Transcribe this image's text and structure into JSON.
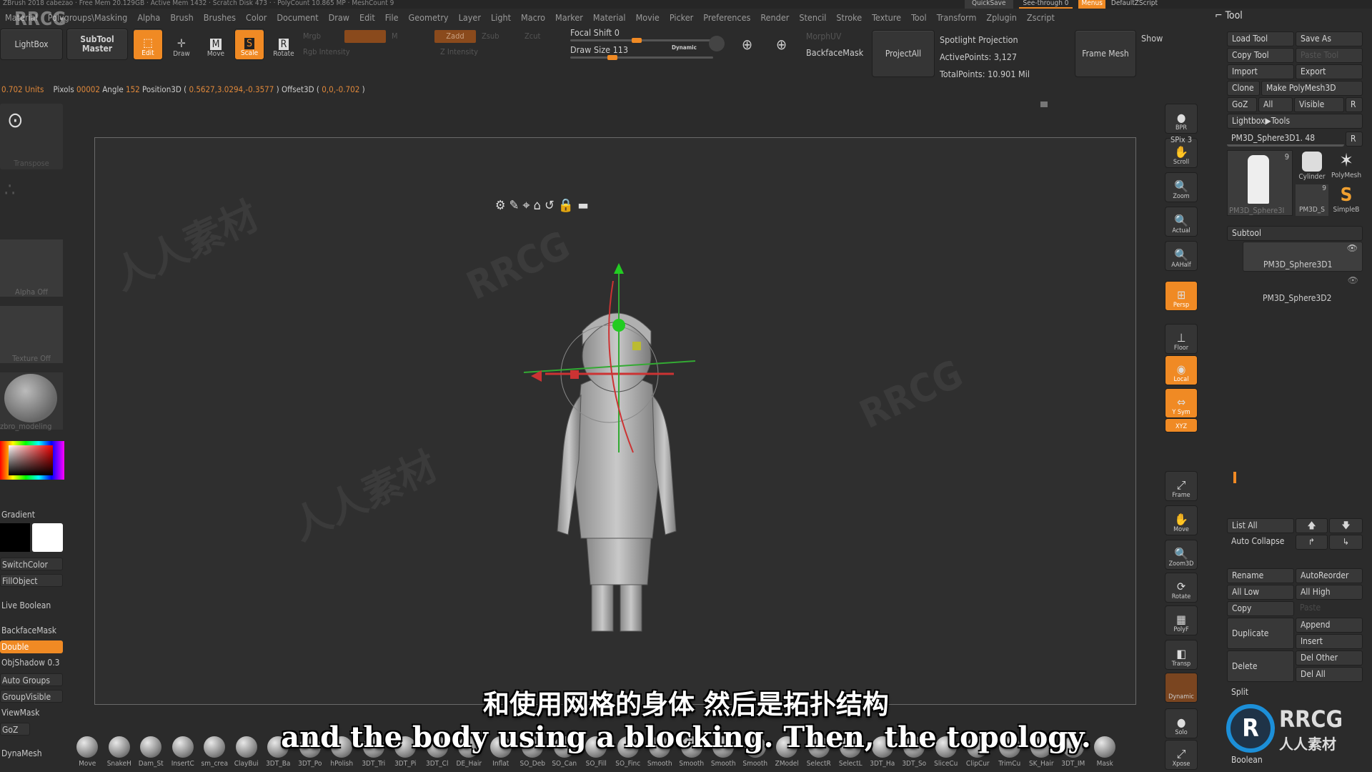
{
  "title_bar": "ZBrush 2018   cabezao  ·  Free Mem 20.129GB · Active Mem 1432 · Scratch Disk 473 ·  · PolyCount 10.865 MP  · MeshCount 9",
  "top_right": {
    "quicksave": "QuickSave",
    "see_through": "See-through 0",
    "menus": "Menus",
    "default_zscript": "DefaultZScript"
  },
  "menus": [
    "Material",
    "Polygroups\\Masking",
    "Alpha",
    "Brush",
    "Brushes",
    "Color",
    "Document",
    "Draw",
    "Edit",
    "File",
    "Geometry",
    "Layer",
    "Light",
    "Macro",
    "Marker",
    "Material",
    "Movie",
    "Picker",
    "Preferences",
    "Render",
    "Stencil",
    "Stroke",
    "Texture",
    "Tool",
    "Transform",
    "Zplugin",
    "Zscript"
  ],
  "toolbar": {
    "lightbox": "LightBox",
    "subtool_master": "SubTool Master",
    "edit": "Edit",
    "draw": "Draw",
    "move": "Move",
    "scale": "Scale",
    "rotate": "Rotate",
    "mrgb": "Mrgb",
    "rgb": "Rgb",
    "m": "M",
    "zadd": "Zadd",
    "zsub": "Zsub",
    "zcut": "Zcut",
    "rgb_intensity": "Rgb Intensity",
    "z_intensity": "Z Intensity",
    "focal_shift": "Focal Shift 0",
    "draw_size": "Draw Size 113",
    "dynamic": "Dynamic",
    "focal_shift_value": 0,
    "draw_size_value": 113,
    "morph_uv": "MorphUV",
    "backface_mask": "BackfaceMask",
    "project_all": "ProjectAll",
    "spotlight_projection": "Spotlight Projection",
    "active_points": "ActivePoints: 3,127",
    "total_points": "TotalPoints: 10.901 Mil",
    "frame_mesh": "Frame Mesh",
    "show": "Show"
  },
  "status": {
    "units": "0.702 Units",
    "pixols_label": "Pixols",
    "pixols": "00002",
    "angle_label": "Angle",
    "angle": "152",
    "pos_label": "Position3D (",
    "pos": "0.5627,3.0294,-0.3577",
    "pos_end": ")",
    "offset_label": "Offset3D (",
    "offset": "0,0,-0.702",
    "offset_end": ")"
  },
  "left_panel": {
    "transpose": "Transpose",
    "alpha_off": "Alpha Off",
    "texture_off": "Texture Off",
    "material": "zbro_modeling",
    "gradient": "Gradient",
    "switch_color": "SwitchColor",
    "fill_object": "FillObject",
    "live_boolean": "Live Boolean",
    "backface_mask": "BackfaceMask",
    "double": "Double",
    "obj_shadow": "ObjShadow 0.3",
    "auto_groups": "Auto Groups",
    "group_visible": "GroupVisible",
    "view_mask": "ViewMask",
    "goz": "GoZ",
    "dynamesh": "DynaMesh",
    "main_color": "#ffffff",
    "secondary_color": "#000000"
  },
  "shelf": [
    {
      "label": "BPR",
      "icon": "bpr-icon",
      "glyph": "●"
    },
    {
      "label": "Scroll",
      "icon": "hand-scroll-icon",
      "glyph": "✋"
    },
    {
      "label": "Zoom",
      "icon": "zoom-icon",
      "glyph": "🔍"
    },
    {
      "label": "Actual",
      "icon": "actual-size-icon",
      "glyph": "🔍"
    },
    {
      "label": "AAHalf",
      "icon": "aahalf-icon",
      "glyph": "🔍"
    },
    {
      "label": "Persp",
      "icon": "perspective-icon",
      "glyph": "⊞",
      "active": true
    },
    {
      "label": "Floor",
      "icon": "floor-icon",
      "glyph": "⊥"
    },
    {
      "label": "Local",
      "icon": "local-icon",
      "glyph": "◉",
      "active": true
    },
    {
      "label": "Y Sym",
      "icon": "symmetry-icon",
      "glyph": "⇔",
      "active": true
    },
    {
      "label": "XYZ",
      "icon": "xyz-rotate-icon",
      "glyph": "",
      "active": true
    },
    {
      "label": "Frame",
      "icon": "frame-icon",
      "glyph": "⤢"
    },
    {
      "label": "Move",
      "icon": "move-view-icon",
      "glyph": "✋"
    },
    {
      "label": "Zoom3D",
      "icon": "zoom3d-icon",
      "glyph": "🔍"
    },
    {
      "label": "Rotate",
      "icon": "rotate-view-icon",
      "glyph": "⟳"
    },
    {
      "label": "PolyF",
      "icon": "polyframe-icon",
      "glyph": "▦"
    },
    {
      "label": "Transp",
      "icon": "transparency-icon",
      "glyph": "◧"
    },
    {
      "label": "Dynamic",
      "icon": "dynamic-icon",
      "glyph": ""
    },
    {
      "label": "Solo",
      "icon": "solo-icon",
      "glyph": "●"
    },
    {
      "label": "Xpose",
      "icon": "xpose-icon",
      "glyph": "⤢"
    }
  ],
  "shelf_extra": {
    "spix": "SPix 3"
  },
  "tool_panel": {
    "title": "Tool",
    "load_tool": "Load Tool",
    "save_as": "Save As",
    "copy_tool": "Copy Tool",
    "paste_tool": "Paste Tool",
    "import": "Import",
    "export": "Export",
    "clone": "Clone",
    "make_polymesh": "Make PolyMesh3D",
    "goz": "GoZ",
    "all": "All",
    "visible": "Visible",
    "r": "R",
    "lightbox_tools": "Lightbox▶Tools",
    "current_tool": "PM3D_Sphere3D1. 48",
    "thumbs": [
      {
        "label": "PM3D_Sphere3I",
        "count": "9"
      },
      {
        "label": "Cylinder",
        "count": ""
      },
      {
        "label": "PolyMesh",
        "count": ""
      },
      {
        "label": "PM3D_S",
        "count": "9"
      },
      {
        "label": "SimpleB",
        "count": ""
      }
    ],
    "subtool_header": "Subtool",
    "subtools": [
      "PM3D_Sphere3D1",
      "PM3D_Sphere3D2"
    ],
    "list_all": "List All",
    "auto_collapse": "Auto Collapse",
    "rename": "Rename",
    "auto_reorder": "AutoReorder",
    "all_low": "All Low",
    "all_high": "All High",
    "copy": "Copy",
    "paste": "Paste",
    "duplicate": "Duplicate",
    "append": "Append",
    "insert": "Insert",
    "delete": "Delete",
    "del_other": "Del Other",
    "del_all": "Del All",
    "split": "Split",
    "boolean": "Boolean"
  },
  "brushes": [
    "Move",
    "SnakeH",
    "Dam_St",
    "InsertC",
    "sm_crea",
    "ClayBui",
    "3DT_Ba",
    "3DT_Po",
    "hPolish",
    "3DT_Tri",
    "3DT_Pi",
    "3DT_Cl",
    "DE_Hair",
    "Inflat",
    "SO_Deb",
    "SO_Can",
    "SO_Fill",
    "SO_Finc",
    "Smooth",
    "Smooth",
    "Smooth",
    "Smooth",
    "ZModel",
    "SelectR",
    "SelectL",
    "3DT_Ha",
    "3DT_So",
    "SliceCu",
    "ClipCur",
    "TrimCu",
    "SK_Hair",
    "3DT_IM",
    "Mask"
  ],
  "subtitles": {
    "zh": "和使用网格的身体 然后是拓扑结构",
    "en": "and the body using a blocking. Then, the topology."
  },
  "watermark": {
    "text": "RRCG",
    "text_zh": "人人素材",
    "logo_text": "RRCG",
    "logo_sub": "人人素材"
  },
  "accent_color": "#f08a24"
}
